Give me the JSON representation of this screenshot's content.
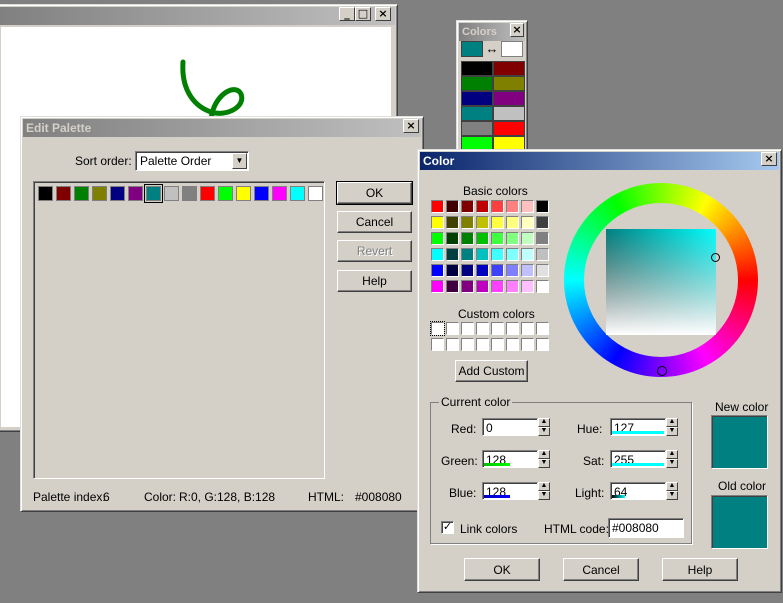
{
  "paint_window": {
    "buttons": [
      "_",
      "□",
      "×"
    ]
  },
  "colors_toolbar": {
    "title": "Colors",
    "close": "×",
    "swap": "↔",
    "fg": "#008080",
    "bg": "#ffffff",
    "swatches": [
      [
        "#000000",
        "#800000"
      ],
      [
        "#008000",
        "#808000"
      ],
      [
        "#000080",
        "#800080"
      ],
      [
        "#008080",
        "#c0c0c0"
      ],
      [
        "#808080",
        "#ff0000"
      ],
      [
        "#00ff00",
        "#ffff00"
      ]
    ]
  },
  "edit_palette": {
    "title": "Edit Palette",
    "close": "×",
    "sort_label": "Sort order:",
    "sort_value": "Palette Order",
    "swatches": [
      "#000000",
      "#800000",
      "#008000",
      "#808000",
      "#000080",
      "#800080",
      "#008080",
      "#c0c0c0",
      "#808080",
      "#ff0000",
      "#00ff00",
      "#ffff00",
      "#0000ff",
      "#ff00ff",
      "#00ffff",
      "#ffffff"
    ],
    "selected_index": 6,
    "buttons": {
      "ok": "OK",
      "cancel": "Cancel",
      "revert": "Revert",
      "help": "Help"
    },
    "status": {
      "index_label": "Palette index:",
      "index_value": "6",
      "color_label": "Color:",
      "color_value": "R:0, G:128, B:128",
      "html_label": "HTML:",
      "html_value": "#008080"
    }
  },
  "color_dialog": {
    "title": "Color",
    "close": "×",
    "basic_label": "Basic colors",
    "basic_colors": [
      [
        "#ff0000",
        "#400000",
        "#800000",
        "#c00000",
        "#ff4040",
        "#ff8080",
        "#ffc0c0",
        "#000000"
      ],
      [
        "#ffff00",
        "#404000",
        "#808000",
        "#c0c000",
        "#ffff40",
        "#ffff80",
        "#ffffc0",
        "#404040"
      ],
      [
        "#00ff00",
        "#004000",
        "#008000",
        "#00c000",
        "#40ff40",
        "#80ff80",
        "#c0ffc0",
        "#808080"
      ],
      [
        "#00ffff",
        "#004040",
        "#008080",
        "#00c0c0",
        "#40ffff",
        "#80ffff",
        "#c0ffff",
        "#c0c0c0"
      ],
      [
        "#0000ff",
        "#000040",
        "#000080",
        "#0000c0",
        "#4040ff",
        "#8080ff",
        "#c0c0ff",
        "#e0e0e0"
      ],
      [
        "#ff00ff",
        "#400040",
        "#800080",
        "#c000c0",
        "#ff40ff",
        "#ff80ff",
        "#ffc0ff",
        "#ffffff"
      ]
    ],
    "custom_label": "Custom colors",
    "add_custom": "Add Custom",
    "current_label": "Current color",
    "fields": {
      "red_label": "Red:",
      "red": "0",
      "green_label": "Green:",
      "green": "128",
      "blue_label": "Blue:",
      "blue": "128",
      "hue_label": "Hue:",
      "hue": "127",
      "sat_label": "Sat:",
      "sat": "255",
      "light_label": "Light:",
      "light": "64"
    },
    "link_label": "Link colors",
    "link_checked": true,
    "html_code_label": "HTML code:",
    "html_code": "#008080",
    "new_label": "New color",
    "old_label": "Old color",
    "new_color": "#008080",
    "old_color": "#008080",
    "buttons": {
      "ok": "OK",
      "cancel": "Cancel",
      "help": "Help"
    }
  }
}
